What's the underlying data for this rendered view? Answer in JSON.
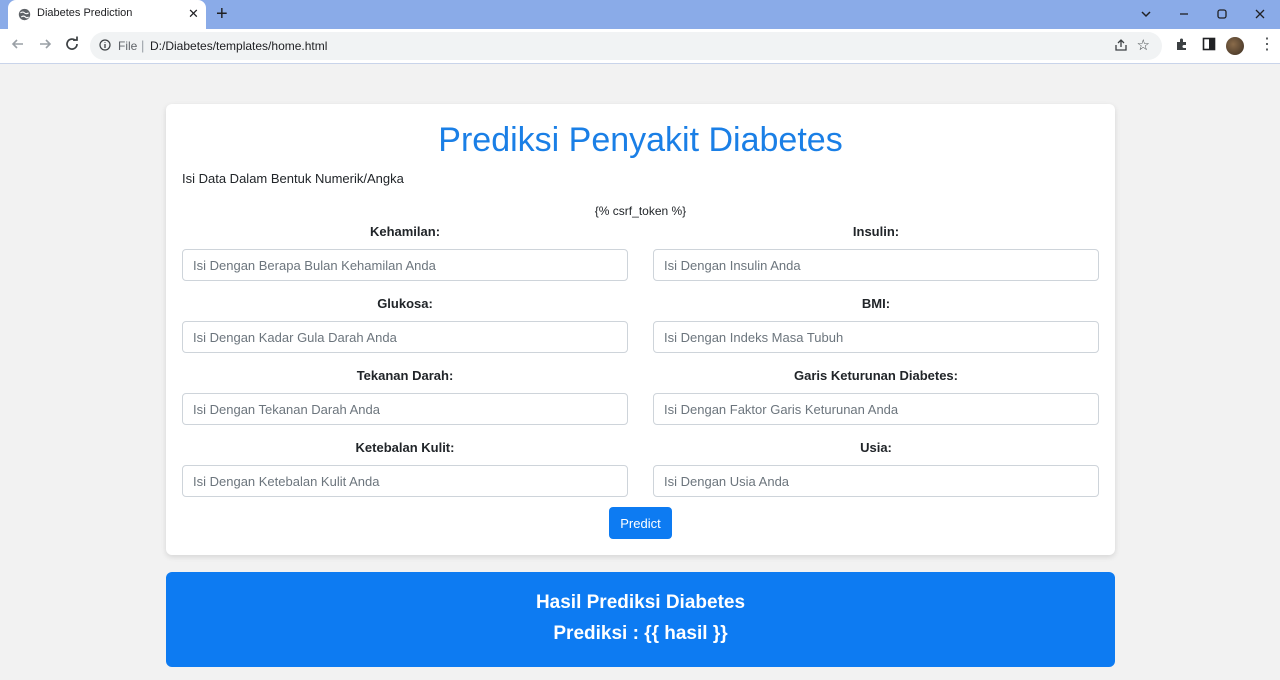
{
  "browser": {
    "tab_title": "Diabetes Prediction",
    "tab_close": "✕",
    "new_tab": "+",
    "file_label": "File",
    "separator": "|",
    "url": "D:/Diabetes/templates/home.html",
    "icons": [
      "globe-icon",
      "back-icon",
      "forward-icon",
      "reload-icon",
      "info-icon",
      "share-icon",
      "star-icon",
      "extensions-icon",
      "sidepanel-icon",
      "avatar",
      "menu-icon"
    ]
  },
  "page": {
    "title": "Prediksi Penyakit Diabetes",
    "subtitle": "Isi Data Dalam Bentuk Numerik/Angka",
    "csrf": "{% csrf_token %}",
    "fields": [
      {
        "label": "Kehamilan:",
        "placeholder": "Isi Dengan Berapa Bulan Kehamilan Anda"
      },
      {
        "label": "Insulin:",
        "placeholder": "Isi Dengan Insulin Anda"
      },
      {
        "label": "Glukosa:",
        "placeholder": "Isi Dengan Kadar Gula Darah Anda"
      },
      {
        "label": "BMI:",
        "placeholder": "Isi Dengan Indeks Masa Tubuh"
      },
      {
        "label": "Tekanan Darah:",
        "placeholder": "Isi Dengan Tekanan Darah Anda"
      },
      {
        "label": "Garis Keturunan Diabetes:",
        "placeholder": "Isi Dengan Faktor Garis Keturunan Anda"
      },
      {
        "label": "Ketebalan Kulit:",
        "placeholder": "Isi Dengan Ketebalan Kulit Anda"
      },
      {
        "label": "Usia:",
        "placeholder": "Isi Dengan Usia Anda"
      }
    ],
    "predict_label": "Predict",
    "result_title": "Hasil Prediksi Diabetes",
    "result_value": "Prediksi : {{ hasil }}"
  },
  "colors": {
    "accent": "#0d7bf2",
    "title": "#1a7fe6",
    "tabbar": "#8aabe8"
  }
}
